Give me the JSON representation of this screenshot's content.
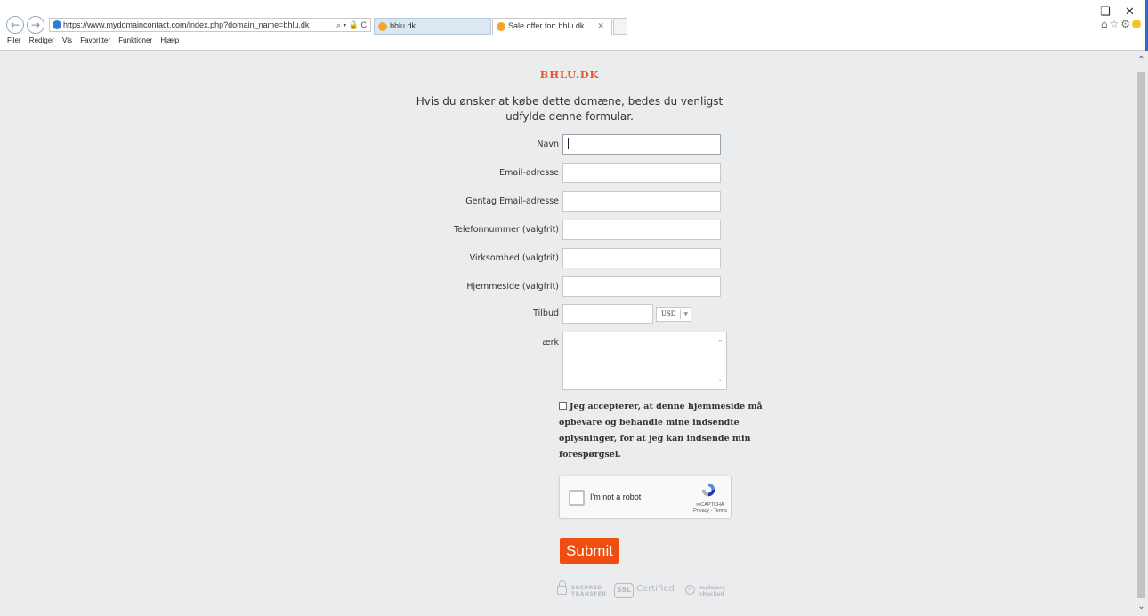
{
  "browser": {
    "url": "https://www.mydomaincontact.com/index.php?domain_name=bhlu.dk",
    "tabs": [
      {
        "label": "bhlu.dk"
      },
      {
        "label": "Sale offer for: bhlu.dk"
      }
    ],
    "menu": [
      "Filer",
      "Rediger",
      "Vis",
      "Favoritter",
      "Funktioner",
      "Hjælp"
    ],
    "address_controls": "⌕ ▾ 🔒 C"
  },
  "page": {
    "site_title": "BHLU.DK",
    "intro": "Hvis du ønsker at købe dette domæne, bedes du venligst udfylde denne formular.",
    "fields": [
      {
        "label": "Navn",
        "value": ""
      },
      {
        "label": "Email-adresse",
        "value": ""
      },
      {
        "label": "Gentag Email-adresse",
        "value": ""
      },
      {
        "label": "Telefonnummer (valgfrit)",
        "value": ""
      },
      {
        "label": "Virksomhed (valgfrit)",
        "value": ""
      },
      {
        "label": "Hjemmeside (valgfrit)",
        "value": ""
      }
    ],
    "offer": {
      "label": "Tilbud",
      "value": "",
      "currency": "USD"
    },
    "remark": {
      "label": "ærk",
      "value": ""
    },
    "consent": "Jeg accepterer, at denne hjemmeside må opbevare og behandle mine indsendte oplysninger, for at jeg kan indsende min forespørgsel.",
    "recaptcha": {
      "label": "I'm not a robot",
      "brand": "reCAPTCHA",
      "links": "Privacy - Terms"
    },
    "submit": "Submit",
    "badges": {
      "secured": "SECURED TRANSFER",
      "ssl": "SSL",
      "certified": "Certified",
      "malware": "malware checked"
    }
  },
  "colors": {
    "accent": "#f04e0f",
    "title": "#e8562a",
    "background": "#eaecee"
  }
}
